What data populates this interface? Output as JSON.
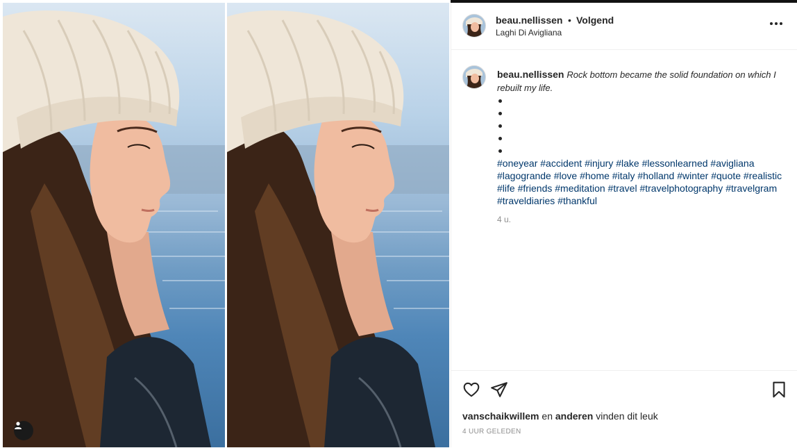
{
  "post": {
    "username": "beau.nellissen",
    "separator": "•",
    "follow_status": "Volgend",
    "location": "Laghi Di Avigliana",
    "caption_quote": "Rock bottom became the solid foundation on which I rebuilt my life.",
    "bullet_count": 5,
    "hashtags": "#oneyear #accident #injury #lake #lessonlearned #avigliana #lagogrande #love #home #italy #holland #winter #quote #realistic #life #friends #meditation #travel #travelphotography #travelgram #traveldiaries #thankful",
    "comment_time": "4 u.",
    "liked_by_user": "vanschaikwillem",
    "liked_by_connector": "en",
    "liked_by_others": "anderen",
    "liked_by_suffix": "vinden dit leuk",
    "posted_time": "4 UUR GELEDEN"
  },
  "icons": {
    "like": "heart-outline-icon",
    "share": "paper-plane-icon",
    "save": "bookmark-outline-icon",
    "more": "more-dots-icon",
    "tagged_users": "user-tag-icon"
  },
  "colors": {
    "text": "#262626",
    "hashtag": "#00376b",
    "muted": "#8e8e8e",
    "divider": "#efefef"
  }
}
